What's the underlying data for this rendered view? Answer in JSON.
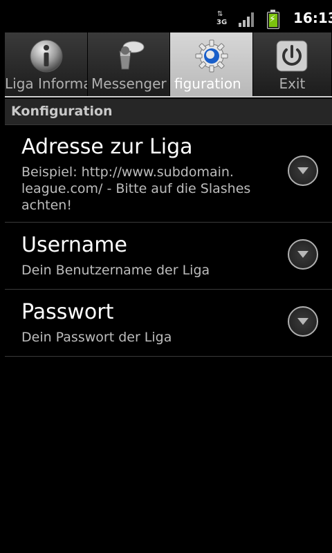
{
  "status_bar": {
    "network_label": "3G",
    "time": "16:13",
    "icons": [
      "3g-data-icon",
      "signal-strength-icon",
      "battery-charging-icon"
    ]
  },
  "tabs": [
    {
      "label": "Liga Informa",
      "icon": "info-icon",
      "active": false
    },
    {
      "label": "Messenger",
      "icon": "messenger-icon",
      "active": false
    },
    {
      "label": "figuration",
      "icon": "settings-gear-icon",
      "active": true
    },
    {
      "label": "Exit",
      "icon": "power-icon",
      "active": false
    }
  ],
  "section": {
    "title": "Konfiguration"
  },
  "preferences": [
    {
      "title": "Adresse zur Liga",
      "summary": "Beispiel: http://www.subdomain. league.com/ - Bitte auf die Slashes achten!"
    },
    {
      "title": "Username",
      "summary": "Dein Benutzername der Liga"
    },
    {
      "title": "Passwort",
      "summary": "Dein Passwort der Liga"
    }
  ],
  "colors": {
    "background": "#000000",
    "tab_active": "#c8c8c8",
    "section_header": "#262626",
    "battery": "#7cc20f"
  }
}
